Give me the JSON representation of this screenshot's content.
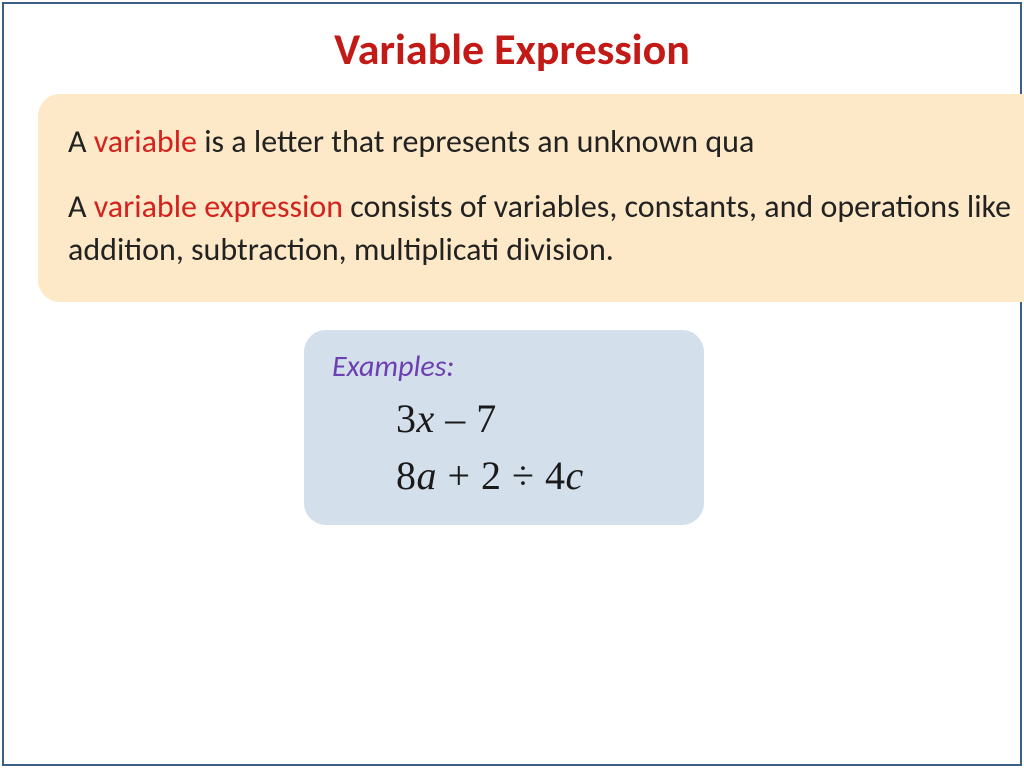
{
  "title": "Variable Expression",
  "definition": {
    "p1_a": "A ",
    "p1_term": "variable",
    "p1_b": " is a letter that represents an unknown qua",
    "p2_a": "A ",
    "p2_term": "variable expression",
    "p2_b": " consists of variables, constants, and operations like addition, subtraction, multiplicati division."
  },
  "examples": {
    "label": "Examples:",
    "line1": {
      "a": "3",
      "b": "x",
      "c": " – 7"
    },
    "line2": {
      "a": "8",
      "b": "a",
      "c": " + 2 ÷ 4",
      "d": "c"
    }
  }
}
